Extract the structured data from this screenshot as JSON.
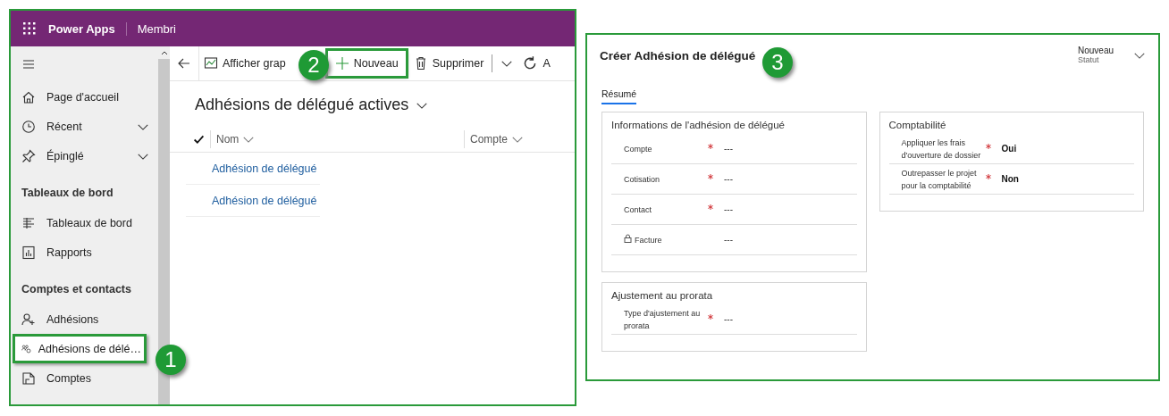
{
  "app": {
    "title": "Power Apps",
    "environment": "Membri"
  },
  "sidebar": {
    "items": [
      {
        "kind": "item",
        "label": "Page d'accueil",
        "selected": false
      },
      {
        "kind": "item",
        "label": "Récent",
        "expanded": false,
        "selected": false
      },
      {
        "kind": "item",
        "label": "Épinglé",
        "expanded": false,
        "selected": false
      },
      {
        "kind": "header",
        "label": "Tableaux de bord"
      },
      {
        "kind": "item",
        "label": "Tableaux de bord",
        "selected": false
      },
      {
        "kind": "item",
        "label": "Rapports",
        "selected": false
      },
      {
        "kind": "header",
        "label": "Comptes et contacts"
      },
      {
        "kind": "item",
        "label": "Adhésions",
        "selected": false
      },
      {
        "kind": "item",
        "label": "Adhésions de délé…",
        "selected": true
      },
      {
        "kind": "item",
        "label": "Comptes",
        "selected": false
      }
    ]
  },
  "toolbar": [
    {
      "kind": "back"
    },
    {
      "kind": "chart",
      "label": "Afficher grap",
      "highlighted": false
    },
    {
      "kind": "new",
      "label": "Nouveau",
      "highlighted": true
    },
    {
      "kind": "delete",
      "label": "Supprimer",
      "highlighted": false
    },
    {
      "kind": "split"
    },
    {
      "kind": "refresh",
      "label": "A",
      "highlighted": false
    }
  ],
  "view": {
    "title": "Adhésions de délégué actives",
    "columns": [
      "Nom",
      "Compte"
    ],
    "rows": [
      "Adhésion de délégué",
      "Adhésion de délégué"
    ]
  },
  "callouts": [
    "1",
    "2",
    "3"
  ],
  "form": {
    "title": "Créer Adhésion de délégué",
    "status_value": "Nouveau",
    "status_label": "Statut",
    "tabs": [
      {
        "label": "Résumé",
        "selected": true
      }
    ],
    "columns": [
      [
        {
          "title": "Informations de l'adhésion de délégué",
          "fields": [
            {
              "label": "Compte",
              "required": true,
              "locked": false,
              "value": "---",
              "empty": true
            },
            {
              "label": "Cotisation",
              "required": true,
              "locked": false,
              "value": "---",
              "empty": true
            },
            {
              "label": "Contact",
              "required": true,
              "locked": false,
              "value": "---",
              "empty": true
            },
            {
              "label": "Facture",
              "required": false,
              "locked": true,
              "value": "---",
              "empty": true
            }
          ]
        },
        {
          "title": "Ajustement au prorata",
          "fields": [
            {
              "label": "Type d'ajustement au prorata",
              "required": true,
              "locked": false,
              "value": "---",
              "empty": true
            }
          ]
        }
      ],
      [
        {
          "title": "Comptabilité",
          "fields": [
            {
              "label": "Appliquer les frais d'ouverture de dossier",
              "required": true,
              "locked": false,
              "value": "Oui",
              "empty": false
            },
            {
              "label": "Outrepasser le projet pour la comptabilité",
              "required": true,
              "locked": false,
              "value": "Non",
              "empty": false
            }
          ]
        }
      ]
    ]
  }
}
